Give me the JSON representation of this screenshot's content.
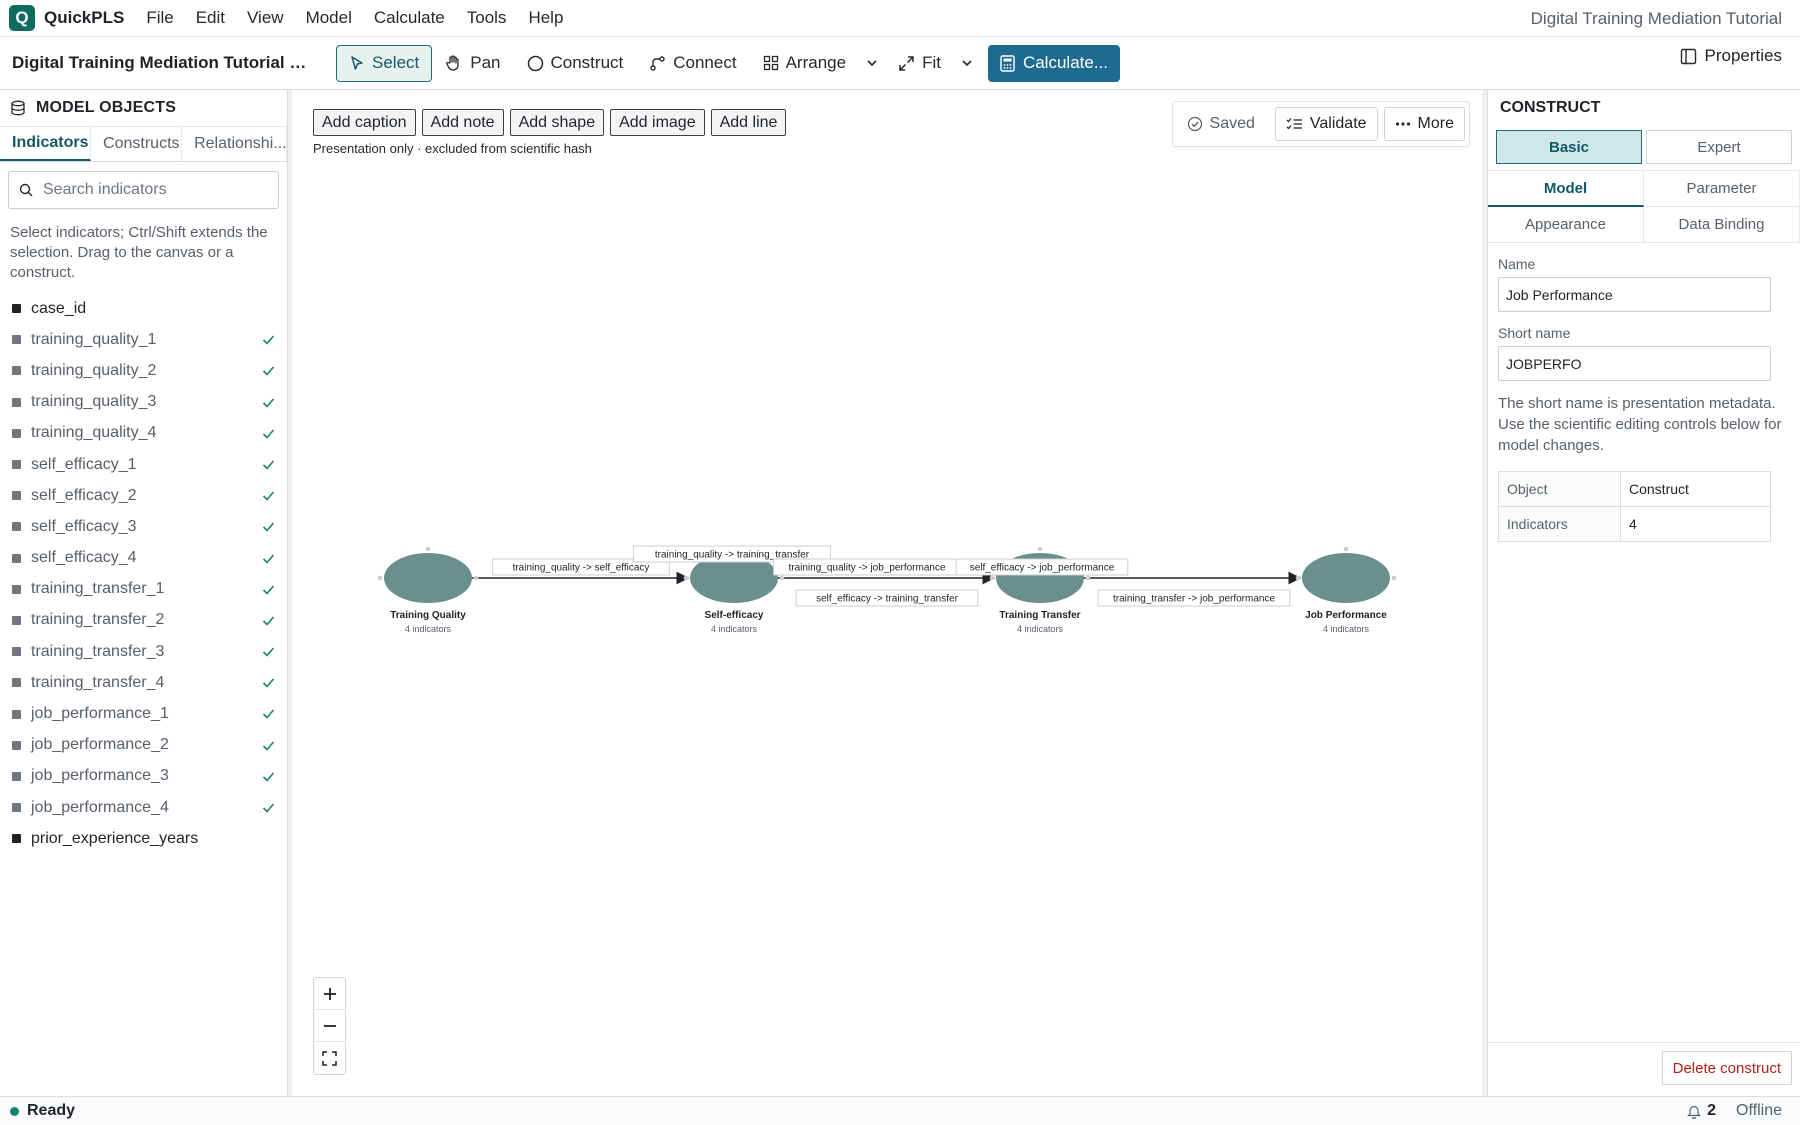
{
  "app": {
    "logo_letter": "Q",
    "name": "QuickPLS",
    "window_title": "Digital Training Mediation Tutorial"
  },
  "menu": [
    "File",
    "Edit",
    "View",
    "Model",
    "Calculate",
    "Tools",
    "Help"
  ],
  "toolbar": {
    "project_title": "Digital Training Mediation Tutorial M...",
    "select": "Select",
    "pan": "Pan",
    "construct": "Construct",
    "connect": "Connect",
    "arrange": "Arrange",
    "fit": "Fit",
    "calculate": "Calculate...",
    "properties": "Properties"
  },
  "left_panel": {
    "title": "MODEL OBJECTS",
    "tabs": [
      "Indicators",
      "Constructs",
      "Relationshi..."
    ],
    "search_placeholder": "Search indicators",
    "hint": "Select indicators; Ctrl/Shift extends the selection. Drag to the canvas or a construct.",
    "indicators": [
      {
        "name": "case_id",
        "assigned": false
      },
      {
        "name": "training_quality_1",
        "assigned": true
      },
      {
        "name": "training_quality_2",
        "assigned": true
      },
      {
        "name": "training_quality_3",
        "assigned": true
      },
      {
        "name": "training_quality_4",
        "assigned": true
      },
      {
        "name": "self_efficacy_1",
        "assigned": true
      },
      {
        "name": "self_efficacy_2",
        "assigned": true
      },
      {
        "name": "self_efficacy_3",
        "assigned": true
      },
      {
        "name": "self_efficacy_4",
        "assigned": true
      },
      {
        "name": "training_transfer_1",
        "assigned": true
      },
      {
        "name": "training_transfer_2",
        "assigned": true
      },
      {
        "name": "training_transfer_3",
        "assigned": true
      },
      {
        "name": "training_transfer_4",
        "assigned": true
      },
      {
        "name": "job_performance_1",
        "assigned": true
      },
      {
        "name": "job_performance_2",
        "assigned": true
      },
      {
        "name": "job_performance_3",
        "assigned": true
      },
      {
        "name": "job_performance_4",
        "assigned": true
      },
      {
        "name": "prior_experience_years",
        "assigned": false
      }
    ]
  },
  "canvas": {
    "decorations": [
      "Add caption",
      "Add note",
      "Add shape",
      "Add image",
      "Add line"
    ],
    "decoration_note": "Presentation only · excluded from scientific hash",
    "actions": {
      "saved": "Saved",
      "validate": "Validate",
      "more": "More"
    },
    "constructs": [
      {
        "name": "Training Quality",
        "sub": "4 indicators"
      },
      {
        "name": "Self-efficacy",
        "sub": "4 indicators"
      },
      {
        "name": "Training Transfer",
        "sub": "4 indicators"
      },
      {
        "name": "Job Performance",
        "sub": "4 indicators"
      }
    ],
    "paths": [
      "training_quality -> self_efficacy",
      "training_quality -> training_transfer",
      "training_quality -> job_performance",
      "self_efficacy -> job_performance",
      "self_efficacy -> training_transfer",
      "training_transfer -> job_performance"
    ],
    "node_color": "#6b8e8e"
  },
  "right_panel": {
    "title": "CONSTRUCT",
    "modes": [
      "Basic",
      "Expert"
    ],
    "tabs": [
      "Model",
      "Parameter",
      "Appearance",
      "Data Binding"
    ],
    "name_label": "Name",
    "name_value": "Job Performance",
    "short_label": "Short name",
    "short_value": "JOBPERFO",
    "help": "The short name is presentation metadata. Use the scientific editing controls below for model changes.",
    "table": [
      {
        "k": "Object",
        "v": "Construct"
      },
      {
        "k": "Indicators",
        "v": "4"
      }
    ],
    "delete": "Delete construct"
  },
  "status": {
    "text": "Ready",
    "notifications": "2",
    "connection": "Offline"
  }
}
